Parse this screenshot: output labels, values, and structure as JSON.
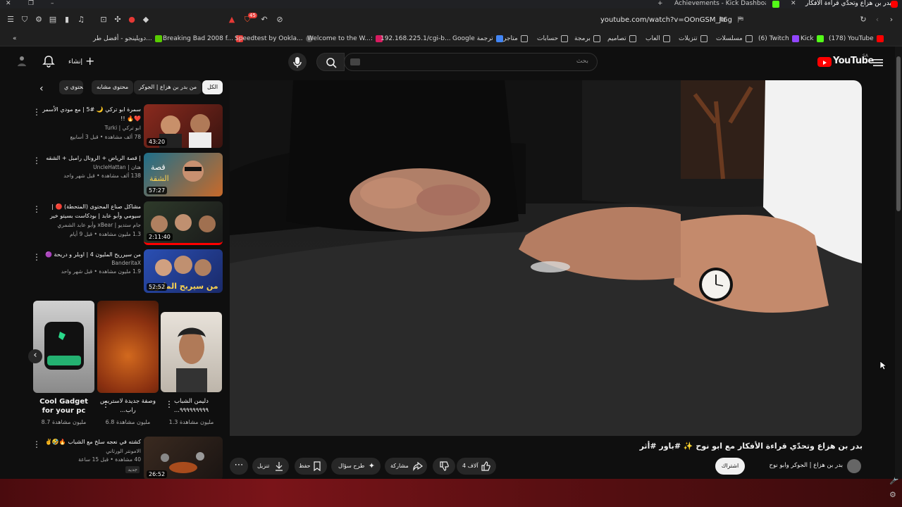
{
  "browser": {
    "tabs": [
      {
        "label": "Achievements - Kick Dashboard",
        "active": false
      },
      {
        "label": "بدر بن هزاع وتحدّي قراءة الأفكار مع",
        "active": true
      }
    ],
    "url": "youtube.com/watch?v=OOnGSM_jI6g",
    "shield_count": "45",
    "bookmarks": [
      {
        "label": "دويلينجو - أفضل طر...",
        "color": "#58cc02"
      },
      {
        "label": "Breaking Bad 2008 f...",
        "color": ""
      },
      {
        "label": "Speedtest by Ookla...",
        "color": "#e63946"
      },
      {
        "label": "Welcome to the W...:",
        "color": "#444"
      },
      {
        "label": "192.168.225.1/cgi-b...",
        "color": "#d81b60"
      },
      {
        "label": "Google ترجمة",
        "color": "#4285f4"
      },
      {
        "label": "متاجر",
        "color": ""
      },
      {
        "label": "حسابات",
        "color": ""
      },
      {
        "label": "برمجة",
        "color": ""
      },
      {
        "label": "تصاميم",
        "color": ""
      },
      {
        "label": "العاب",
        "color": ""
      },
      {
        "label": "تنزيلات",
        "color": ""
      },
      {
        "label": "مسلسلات",
        "color": ""
      },
      {
        "label": "(6) Twitch",
        "color": "#9146ff"
      },
      {
        "label": "Kick",
        "color": "#53fc18"
      },
      {
        "label": "(178) YouTube",
        "color": "#ff0000"
      }
    ]
  },
  "header": {
    "logo": "YouTube",
    "country": "SA",
    "search_placeholder": "بحث",
    "create_label": "إنشاء"
  },
  "chips": [
    "الكل",
    "من بدر بن هزاع | الجوكر",
    "محتوى مشابه",
    "محتوى ي"
  ],
  "related": [
    {
      "title": "سمرة ابو تركي 🌙 #5 | مع مودي الأسمر ❤️🔥 !!",
      "channel": "ابو تركي | Turki",
      "meta": "78 ألف مشاهدة • قبل 3 أسابيع",
      "duration": "43:20",
      "tint": "#8a2a1e"
    },
    {
      "title": "| قصة الرياض + الرونال رامبل + الشقه",
      "channel": "هتان | UncleHattan",
      "meta": "138 ألف مشاهدة • قبل شهر واحد",
      "duration": "57:27",
      "tint": "#1e6f8a"
    },
    {
      "title": "مشاكل صناع المحتوى (المتحطة) 🔴 | سيومي وأبو عابد | بودكاست بسيتو خير",
      "channel": "جام ستديو | xBear وأبو عابد الشمري",
      "meta": "1.3 مليون مشاهدة • قبل 9 أيام",
      "duration": "2:11:40",
      "tint": "#2e3a2a"
    },
    {
      "title": "من سيرريح المليون 4 | اوبلر و دريحة 🟣",
      "channel": "BanderitaX",
      "meta": "1.9 مليون مشاهدة • قبل شهر واحد",
      "duration": "52:52",
      "tint": "#2a4fb3"
    }
  ],
  "shorts": [
    {
      "title": "Cool Gadget for your pc",
      "views": "8.7 مليون مشاهدة",
      "tint": "#3a3a3a"
    },
    {
      "title": "وصفة جديدة لاستربس راب...",
      "views": "6.8 مليون مشاهدة",
      "tint": "#b54a1c"
    },
    {
      "title": "دليمن الشباب ٩٩٩٩٩٩٩٩٩...",
      "views": "1.3 مليون مشاهدة",
      "tint": "#cfc8c0"
    }
  ],
  "bottom_item": {
    "title": "كشته في نعجه سلخ مع الشباب 🔥🤣✌️",
    "channel": "الامونتر الورثاني",
    "meta": "40 مشاهدة • قبل 15 ساعة",
    "badge": "جديد",
    "duration": "26:52"
  },
  "video": {
    "title": "بدر بن هزاع وتحدّي قراءة الأفكار مع ابو نوح ✨ #باور #أثر",
    "channel": "بدر بن هزاع | الجوكر وابو نوح",
    "subscribe": "اشتراك",
    "likes": "4 آلاف",
    "share": "مشاركة",
    "ask": "طرح سؤال",
    "save": "حفظ",
    "download": "تنزيل"
  },
  "icons": {
    "mic": "mic-icon",
    "search": "search-icon",
    "bell": "bell-icon",
    "menu": "menu-icon"
  }
}
